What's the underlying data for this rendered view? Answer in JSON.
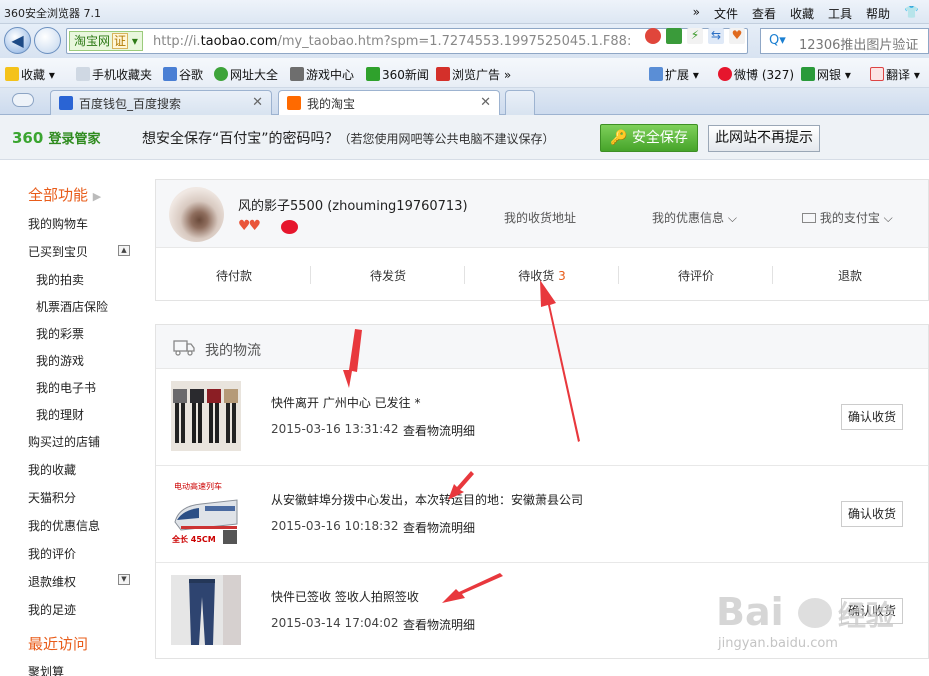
{
  "browser": {
    "title": "360安全浏览器 7.1",
    "menu": [
      "文件",
      "查看",
      "收藏",
      "工具",
      "帮助"
    ],
    "address": {
      "site_badge": "淘宝网",
      "cert_badge": "证",
      "url_prefix": "http://i.",
      "url_domain": "taobao.com",
      "url_rest": "/my_taobao.htm?spm=1.7274553.1997525045.1.F88:"
    },
    "search_text": "12306推出图片验证",
    "favorites": [
      "收藏",
      "手机收藏夹",
      "谷歌",
      "网址大全",
      "游戏中心",
      "360新闻",
      "浏览广告"
    ],
    "favorites_right": [
      "扩展",
      "微博 (327)",
      "网银",
      "翻译"
    ],
    "tabs": [
      {
        "label": "百度钱包_百度搜索"
      },
      {
        "label": "我的淘宝"
      }
    ]
  },
  "password_bar": {
    "logo": "360",
    "logo_sub": "登录管家",
    "message": "想安全保存“百付宝”的密码吗？",
    "note": "（若您使用网吧等公共电脑不建议保存）",
    "save_label": "安全保存",
    "dismiss_label": "此网站不再提示"
  },
  "sidebar": {
    "header": "全部功能",
    "items": [
      {
        "label": "我的购物车",
        "sub": false
      },
      {
        "label": "已买到宝贝",
        "sub": false
      },
      {
        "label": "我的拍卖",
        "sub": true
      },
      {
        "label": "机票酒店保险",
        "sub": true
      },
      {
        "label": "我的彩票",
        "sub": true
      },
      {
        "label": "我的游戏",
        "sub": true
      },
      {
        "label": "我的电子书",
        "sub": true
      },
      {
        "label": "我的理财",
        "sub": true
      },
      {
        "label": "购买过的店铺",
        "sub": false
      },
      {
        "label": "我的收藏",
        "sub": false
      },
      {
        "label": "天猫积分",
        "sub": false
      },
      {
        "label": "我的优惠信息",
        "sub": false
      },
      {
        "label": "我的评价",
        "sub": false
      },
      {
        "label": "退款维权",
        "sub": false
      },
      {
        "label": "我的足迹",
        "sub": false
      }
    ],
    "recent_header": "最近访问",
    "recent_item": "聚划算"
  },
  "profile": {
    "username": "风的影子5500 (zhouming19760713)",
    "links": [
      "我的收货地址",
      "我的优惠信息",
      "我的支付宝"
    ],
    "statuses": [
      {
        "label": "待付款",
        "count": ""
      },
      {
        "label": "待发货",
        "count": ""
      },
      {
        "label": "待收货",
        "count": "3"
      },
      {
        "label": "待评价",
        "count": ""
      },
      {
        "label": "退款",
        "count": ""
      }
    ]
  },
  "logistics": {
    "header": "我的物流",
    "items": [
      {
        "desc": "快件离开 广州中心 已发往 *",
        "date": "2015-03-16 13:31:42",
        "detail": "查看物流明细",
        "button": "确认收货"
      },
      {
        "desc": "从安徽蚌埠分拨中心发出，本次转运目的地：安徽萧县公司",
        "date": "2015-03-16 10:18:32",
        "detail": "查看物流明细",
        "button": "确认收货",
        "thumb_caption": "电动高速列车",
        "thumb_length": "全长 45CM"
      },
      {
        "desc": "快件已签收 签收人拍照签收",
        "date": "2015-03-14 17:04:02",
        "detail": "查看物流明细",
        "button": "确认收货"
      }
    ]
  },
  "watermark": {
    "brand": "Bai",
    "brand2": "经验",
    "url": "jingyan.baidu.com"
  },
  "colors": {
    "accent": "#e85c1a",
    "arrow": "#e8383d",
    "save_green": "#46a42a"
  }
}
